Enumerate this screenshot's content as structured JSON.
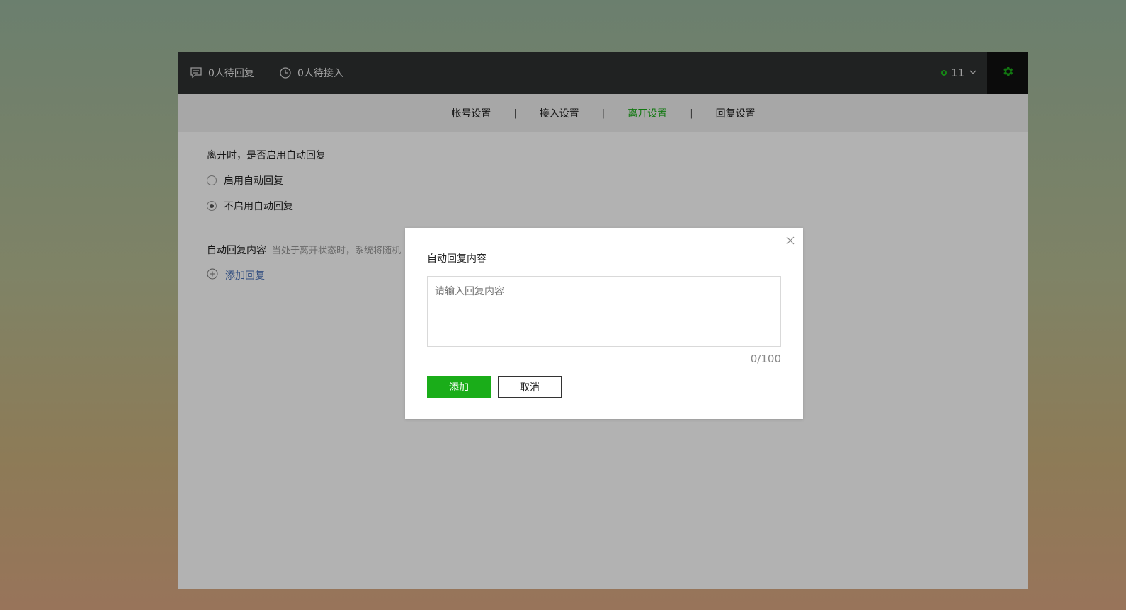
{
  "topbar": {
    "pending_reply": "0人待回复",
    "pending_access": "0人待接入",
    "online_count": "11",
    "accent_color": "#1aad19"
  },
  "tabs": [
    {
      "label": "帐号设置",
      "active": false
    },
    {
      "label": "接入设置",
      "active": false
    },
    {
      "label": "离开设置",
      "active": true
    },
    {
      "label": "回复设置",
      "active": false
    }
  ],
  "tab_separator": "|",
  "leave_settings": {
    "question": "离开时，是否启用自动回复",
    "options": [
      {
        "label": "启用自动回复",
        "selected": false
      },
      {
        "label": "不启用自动回复",
        "selected": true
      }
    ],
    "reply_label": "自动回复内容",
    "reply_hint": "当处于离开状态时，系统将随机",
    "add_reply": "添加回复"
  },
  "dialog": {
    "title": "自动回复内容",
    "placeholder": "请输入回复内容",
    "value": "",
    "counter": "0/100",
    "confirm_label": "添加",
    "cancel_label": "取消"
  }
}
